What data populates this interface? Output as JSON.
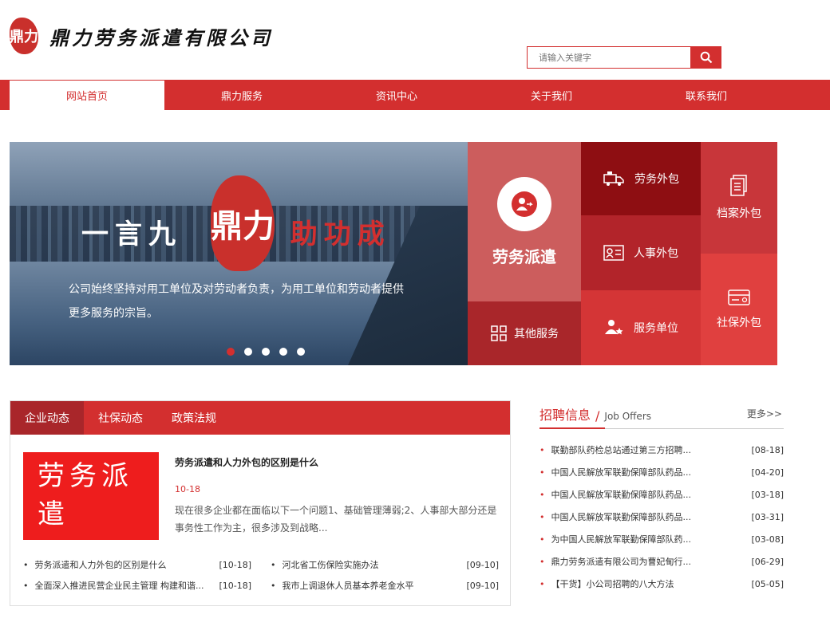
{
  "header": {
    "logo_seal": "鼎力",
    "company_name": "鼎力劳务派遣有限公司"
  },
  "search": {
    "placeholder": "请输入关键字"
  },
  "nav": {
    "items": [
      {
        "label": "网站首页"
      },
      {
        "label": "鼎力服务"
      },
      {
        "label": "资讯中心"
      },
      {
        "label": "关于我们"
      },
      {
        "label": "联系我们"
      }
    ]
  },
  "banner": {
    "slogan_left": "一言九",
    "seal": "鼎力",
    "slogan_right": "助功成",
    "description": "公司始终坚持对用工单位及对劳动者负责，为用工单位和劳动者提供更多服务的宗旨。"
  },
  "services": {
    "main": "劳务派遣",
    "other": "其他服务",
    "labor_outsourcing": "劳务外包",
    "hr_outsourcing": "人事外包",
    "service_unit": "服务单位",
    "archive_outsourcing": "档案外包",
    "social_outsourcing": "社保外包"
  },
  "news": {
    "tabs": [
      {
        "label": "企业动态"
      },
      {
        "label": "社保动态"
      },
      {
        "label": "政策法规"
      }
    ],
    "feature": {
      "image_text": "劳务派遣",
      "title": "劳务派遣和人力外包的区别是什么",
      "date": "10-18",
      "summary": "现在很多企业都在面临以下一个问题1、基础管理薄弱;2、人事部大部分还是事务性工作为主，很多涉及到战略..."
    },
    "list_left": [
      {
        "title": "劳务派遣和人力外包的区别是什么",
        "date": "[10-18]"
      },
      {
        "title": "全面深入推进民营企业民主管理 构建和谐...",
        "date": "[10-18]"
      }
    ],
    "list_right": [
      {
        "title": "河北省工伤保险实施办法",
        "date": "[09-10]"
      },
      {
        "title": "我市上调退休人员基本养老金水平",
        "date": "[09-10]"
      }
    ]
  },
  "jobs": {
    "title_cn": "招聘信息",
    "separator": "/",
    "title_en": "Job Offers",
    "more": "更多>>",
    "items": [
      {
        "title": "联勤部队药检总站通过第三方招聘...",
        "date": "[08-18]"
      },
      {
        "title": "中国人民解放军联勤保障部队药品...",
        "date": "[04-20]"
      },
      {
        "title": "中国人民解放军联勤保障部队药品...",
        "date": "[03-18]"
      },
      {
        "title": "中国人民解放军联勤保障部队药品...",
        "date": "[03-31]"
      },
      {
        "title": "为中国人民解放军联勤保障部队药...",
        "date": "[03-08]"
      },
      {
        "title": "鼎力劳务派遣有限公司为曹妃甸行...",
        "date": "[06-29]"
      },
      {
        "title": "【干货】小公司招聘的八大方法",
        "date": "[05-05]"
      }
    ]
  },
  "colors": {
    "brand_red": "#d32f2f",
    "dark_red": "#8e0e12"
  },
  "carousel": {
    "slide_count": 5,
    "active_index": 0
  }
}
